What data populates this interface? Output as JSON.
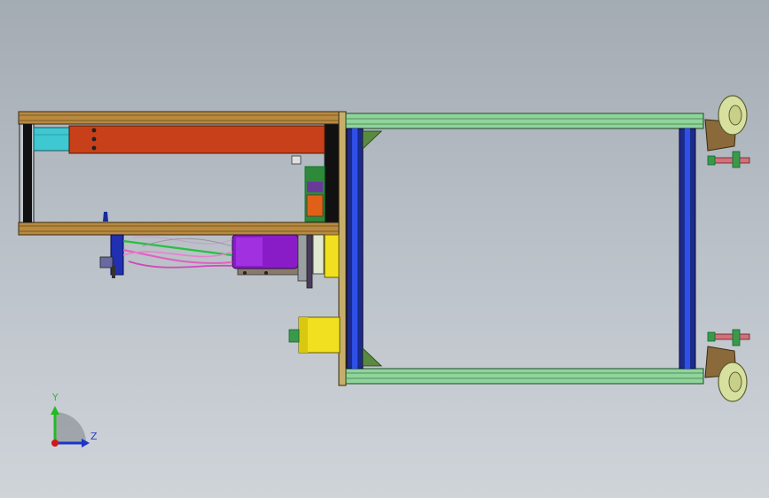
{
  "viewport": {
    "background_top": "#a3abb3",
    "background_bottom": "#cfd4d9"
  },
  "triad": {
    "y_label": "Y",
    "z_label": "Z",
    "y_color": "#22bb22",
    "z_color": "#1a35c8",
    "x_color": "#d01818"
  },
  "colors": {
    "frame_tan": "#b88a40",
    "rail_green": "#90d49c",
    "post_blue": "#2035d0",
    "plate_orange": "#c8401a",
    "block_cyan": "#3ec8d2",
    "motor_purple": "#8a1cc8",
    "box_yellow": "#f0e020",
    "wheel_tan": "#d8e0a0"
  }
}
